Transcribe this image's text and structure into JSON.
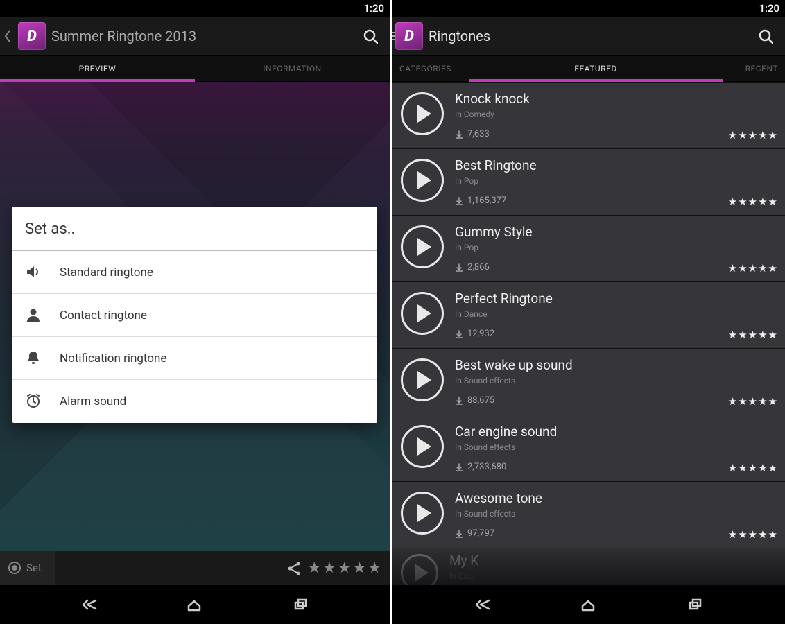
{
  "status": {
    "time": "1:20"
  },
  "left": {
    "title": "Summer Ringtone 2013",
    "tabs": [
      "PREVIEW",
      "INFORMATION"
    ],
    "active_tab": 0,
    "dialog": {
      "title": "Set as..",
      "items": [
        {
          "icon": "volume-icon",
          "label": "Standard ringtone"
        },
        {
          "icon": "person-icon",
          "label": "Contact ringtone"
        },
        {
          "icon": "bell-icon",
          "label": "Notification ringtone"
        },
        {
          "icon": "alarm-icon",
          "label": "Alarm sound"
        }
      ]
    },
    "footer": {
      "set_label": "Set",
      "stars": "★★★★★"
    }
  },
  "right": {
    "title": "Ringtones",
    "tabs": [
      "CATEGORIES",
      "FEATURED",
      "RECENT"
    ],
    "active_tab": 1,
    "items": [
      {
        "title": "Knock knock",
        "category": "In Comedy",
        "downloads": "7,633",
        "stars": "★★★★★"
      },
      {
        "title": "Best Ringtone",
        "category": "In Pop",
        "downloads": "1,165,377",
        "stars": "★★★★★"
      },
      {
        "title": "Gummy Style",
        "category": "In Pop",
        "downloads": "2,866",
        "stars": "★★★★★"
      },
      {
        "title": "Perfect Ringtone",
        "category": "In Dance",
        "downloads": "12,932",
        "stars": "★★★★★"
      },
      {
        "title": "Best wake up sound",
        "category": "In Sound effects",
        "downloads": "88,675",
        "stars": "★★★★★"
      },
      {
        "title": "Car engine sound",
        "category": "In Sound effects",
        "downloads": "2,733,680",
        "stars": "★★★★★"
      },
      {
        "title": "Awesome tone",
        "category": "In Sound effects",
        "downloads": "97,797",
        "stars": "★★★★★"
      },
      {
        "title": "My K",
        "category": "In Cou",
        "downloads": "",
        "stars": ""
      }
    ]
  }
}
